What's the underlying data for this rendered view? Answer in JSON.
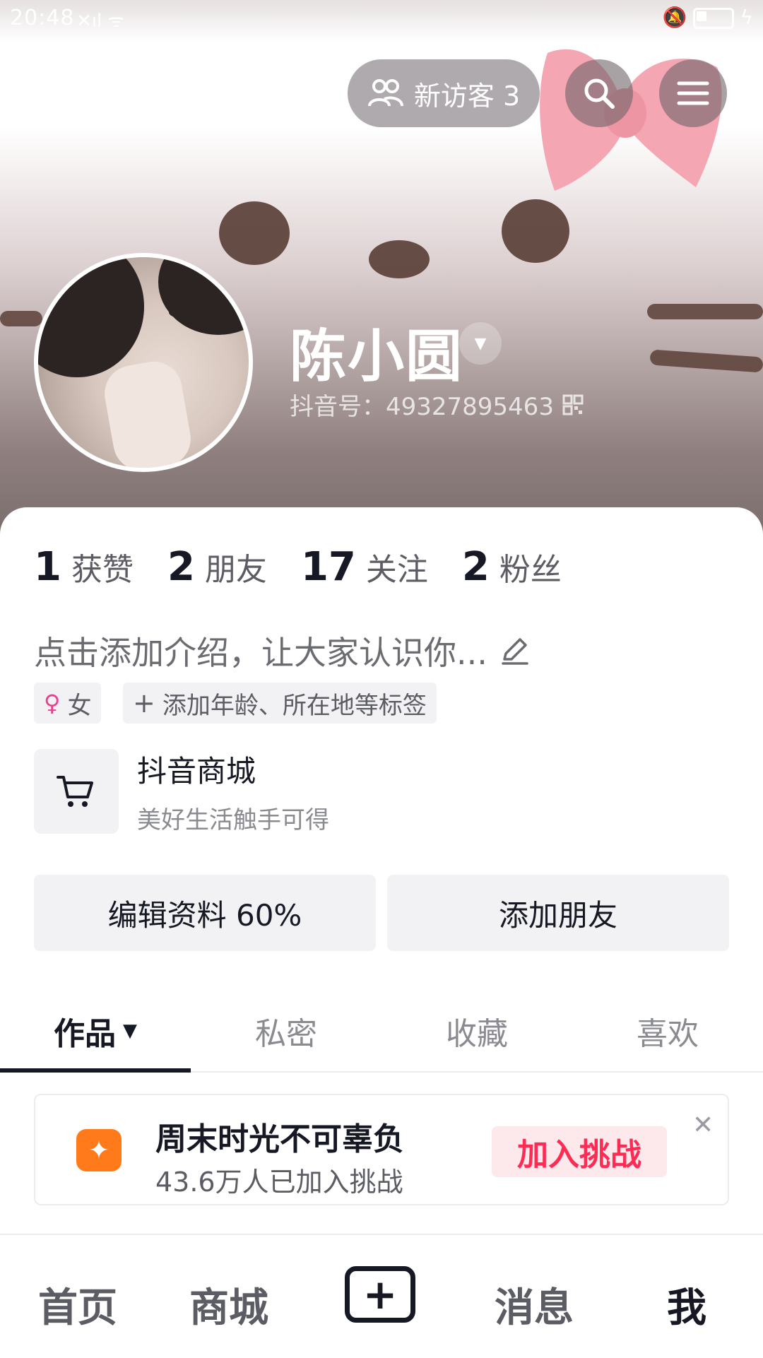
{
  "status_bar": {
    "time": "20:48",
    "signal": "×ıl",
    "right": "🔕"
  },
  "header": {
    "new_visitors_label": "新访客 3",
    "username": "陈小圆",
    "douyin_id": "抖音号：49327895463"
  },
  "stats": [
    {
      "num": "1",
      "label": "获赞"
    },
    {
      "num": "2",
      "label": "朋友"
    },
    {
      "num": "17",
      "label": "关注"
    },
    {
      "num": "2",
      "label": "粉丝"
    }
  ],
  "bio_placeholder": "点击添加介绍，让大家认识你...",
  "tags": {
    "gender": "女",
    "add": "添加年龄、所在地等标签"
  },
  "mall": {
    "title": "抖音商城",
    "subtitle": "美好生活触手可得"
  },
  "actions": {
    "edit_profile": "编辑资料 60%",
    "add_friend": "添加朋友"
  },
  "tabs": [
    {
      "label": "作品"
    },
    {
      "label": "私密"
    },
    {
      "label": "收藏"
    },
    {
      "label": "喜欢"
    }
  ],
  "challenge": {
    "title": "周末时光不可辜负",
    "subtitle": "43.6万人已加入挑战",
    "join_label": "加入挑战"
  },
  "bottom_nav": [
    {
      "label": "首页"
    },
    {
      "label": "商城"
    },
    {
      "label": "消息"
    },
    {
      "label": "我"
    }
  ],
  "colors": {
    "accent": "#fe2c55",
    "challenge_icon": "#ff7a1a",
    "text": "#161823"
  }
}
